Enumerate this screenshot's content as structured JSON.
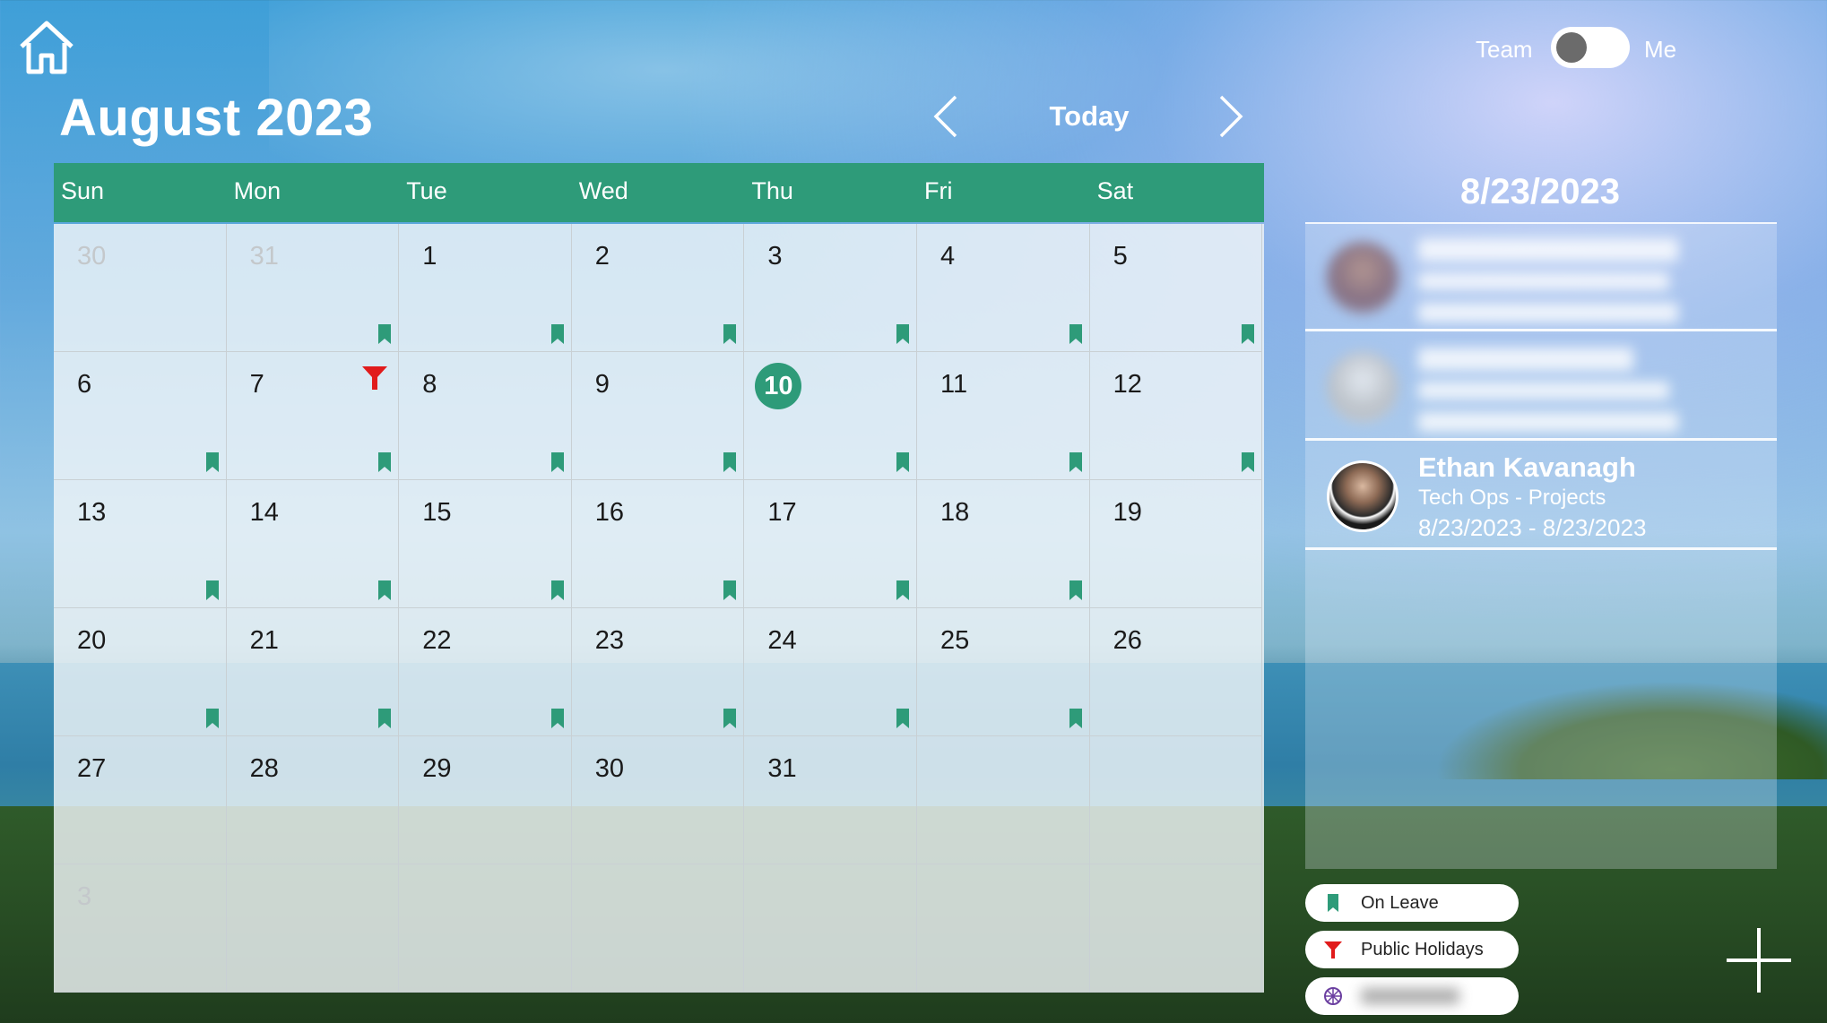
{
  "header": {
    "home_icon": "home-icon",
    "month_title": "August 2023",
    "nav_prev_icon": "chevron-left-icon",
    "today_label": "Today",
    "nav_next_icon": "chevron-right-icon"
  },
  "toggle": {
    "left_label": "Team",
    "right_label": "Me",
    "state": "Team"
  },
  "colors": {
    "accent": "#2e9b79",
    "holiday": "#e11b1b",
    "legend_other": "#6b3fa0"
  },
  "calendar": {
    "day_names": [
      "Sun",
      "Mon",
      "Tue",
      "Wed",
      "Thu",
      "Fri",
      "Sat"
    ],
    "weeks": [
      [
        {
          "day": "30",
          "outside": true,
          "leave": false
        },
        {
          "day": "31",
          "outside": true,
          "leave": true
        },
        {
          "day": "1",
          "outside": false,
          "leave": true
        },
        {
          "day": "2",
          "outside": false,
          "leave": true
        },
        {
          "day": "3",
          "outside": false,
          "leave": true
        },
        {
          "day": "4",
          "outside": false,
          "leave": true
        },
        {
          "day": "5",
          "outside": false,
          "leave": true
        }
      ],
      [
        {
          "day": "6",
          "outside": false,
          "leave": true
        },
        {
          "day": "7",
          "outside": false,
          "leave": true,
          "holiday": true
        },
        {
          "day": "8",
          "outside": false,
          "leave": true
        },
        {
          "day": "9",
          "outside": false,
          "leave": true
        },
        {
          "day": "10",
          "outside": false,
          "leave": true,
          "today": true
        },
        {
          "day": "11",
          "outside": false,
          "leave": true
        },
        {
          "day": "12",
          "outside": false,
          "leave": true
        }
      ],
      [
        {
          "day": "13",
          "outside": false,
          "leave": true
        },
        {
          "day": "14",
          "outside": false,
          "leave": true
        },
        {
          "day": "15",
          "outside": false,
          "leave": true
        },
        {
          "day": "16",
          "outside": false,
          "leave": true
        },
        {
          "day": "17",
          "outside": false,
          "leave": true
        },
        {
          "day": "18",
          "outside": false,
          "leave": true
        },
        {
          "day": "19",
          "outside": false,
          "leave": false
        }
      ],
      [
        {
          "day": "20",
          "outside": false,
          "leave": true
        },
        {
          "day": "21",
          "outside": false,
          "leave": true
        },
        {
          "day": "22",
          "outside": false,
          "leave": true
        },
        {
          "day": "23",
          "outside": false,
          "leave": true
        },
        {
          "day": "24",
          "outside": false,
          "leave": true
        },
        {
          "day": "25",
          "outside": false,
          "leave": true
        },
        {
          "day": "26",
          "outside": false,
          "leave": false
        }
      ],
      [
        {
          "day": "27",
          "outside": false,
          "leave": false
        },
        {
          "day": "28",
          "outside": false,
          "leave": false
        },
        {
          "day": "29",
          "outside": false,
          "leave": false
        },
        {
          "day": "30",
          "outside": false,
          "leave": false
        },
        {
          "day": "31",
          "outside": false,
          "leave": false
        },
        {
          "day": "",
          "outside": true,
          "leave": false
        },
        {
          "day": "",
          "outside": true,
          "leave": false
        }
      ],
      [
        {
          "day": "3",
          "outside": true,
          "leave": false
        },
        {
          "day": "",
          "outside": true,
          "leave": false
        },
        {
          "day": "",
          "outside": true,
          "leave": false
        },
        {
          "day": "",
          "outside": true,
          "leave": false
        },
        {
          "day": "",
          "outside": true,
          "leave": false
        },
        {
          "day": "",
          "outside": true,
          "leave": false
        },
        {
          "day": "",
          "outside": true,
          "leave": false
        }
      ]
    ]
  },
  "side_panel": {
    "selected_date": "8/23/2023",
    "entries": [
      {
        "blurred": true
      },
      {
        "blurred": true
      },
      {
        "name": "Ethan Kavanagh",
        "team": "Tech Ops - Projects",
        "dates": "8/23/2023 - 8/23/2023",
        "blurred": false
      }
    ]
  },
  "legend": [
    {
      "label": "On Leave",
      "icon": "bookmark-icon"
    },
    {
      "label": "Public Holidays",
      "icon": "funnel-flag-icon"
    },
    {
      "label": "",
      "icon": "network-icon",
      "blurred": true
    }
  ],
  "add_button_icon": "plus-icon"
}
